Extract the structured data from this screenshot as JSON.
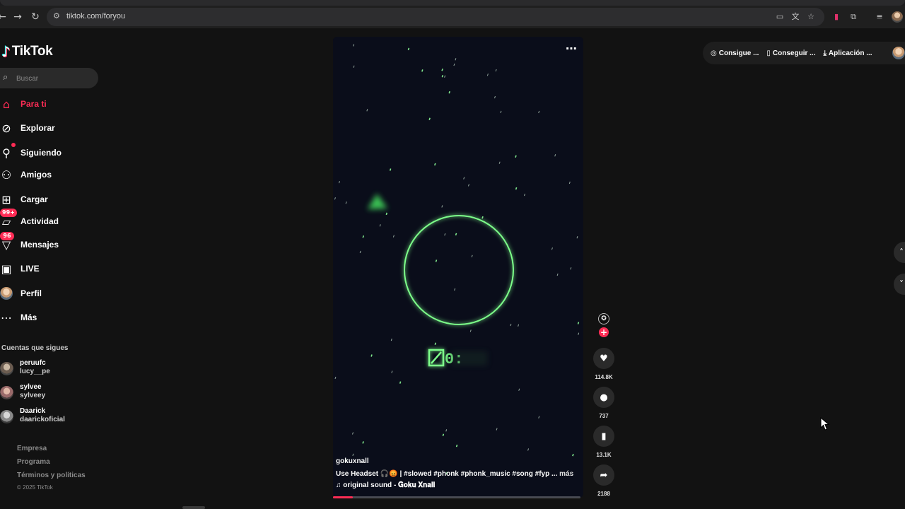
{
  "browser": {
    "url": "tiktok.com/foryou",
    "nav": {
      "back": "←",
      "forward": "→",
      "reload": "↻"
    }
  },
  "brand": {
    "name": "TikTok",
    "logo_icon": "tiktok-note-icon"
  },
  "search": {
    "placeholder": "Buscar"
  },
  "sidebar": {
    "items": [
      {
        "label": "Para ti",
        "icon": "home-icon",
        "active": true
      },
      {
        "label": "Explorar",
        "icon": "compass-icon"
      },
      {
        "label": "Siguiendo",
        "icon": "user-follow-icon"
      },
      {
        "label": "Amigos",
        "icon": "friends-icon"
      },
      {
        "label": "Cargar",
        "icon": "upload-icon"
      },
      {
        "label": "Actividad",
        "icon": "inbox-icon",
        "badge": "99+"
      },
      {
        "label": "Mensajes",
        "icon": "message-icon",
        "badge": "96"
      },
      {
        "label": "LIVE",
        "icon": "live-icon"
      },
      {
        "label": "Perfil",
        "icon": "profile-avatar"
      },
      {
        "label": "Más",
        "icon": "more-icon"
      }
    ],
    "following_title": "Cuentas que sigues",
    "following": [
      {
        "name": "peruufc",
        "handle": "lucy__pe"
      },
      {
        "name": "sylvee",
        "handle": "sylveey"
      },
      {
        "name": "Daarick",
        "handle": "daarickoficial"
      }
    ],
    "footer_links": [
      "Empresa",
      "Programa",
      "Términos y políticas"
    ],
    "copyright": "© 2025 TikTok"
  },
  "video": {
    "author": "gokuxnall",
    "caption": "Use Headset 🎧😡 | #slowed #phonk #phonk_music #song #fyp ...",
    "caption_more": "más",
    "sound": "♫ original sound - 𝐆𝐨𝐤𝐮 𝐗𝐧𝐚𝐥𝐥",
    "timer_text": "0:",
    "progress": 0.08,
    "accent_color": "#7dff8a"
  },
  "actions": {
    "likes": "114.8K",
    "comments": "737",
    "saves": "13.1K",
    "shares": "2188"
  },
  "topbar": {
    "items": [
      {
        "label": "Consigue ...",
        "icon": "coin-icon"
      },
      {
        "label": "Conseguir ...",
        "icon": "phone-icon"
      },
      {
        "label": "Aplicación ...",
        "icon": "download-icon"
      }
    ]
  },
  "colors": {
    "brand_red": "#fe2c55",
    "bg": "#121212"
  }
}
